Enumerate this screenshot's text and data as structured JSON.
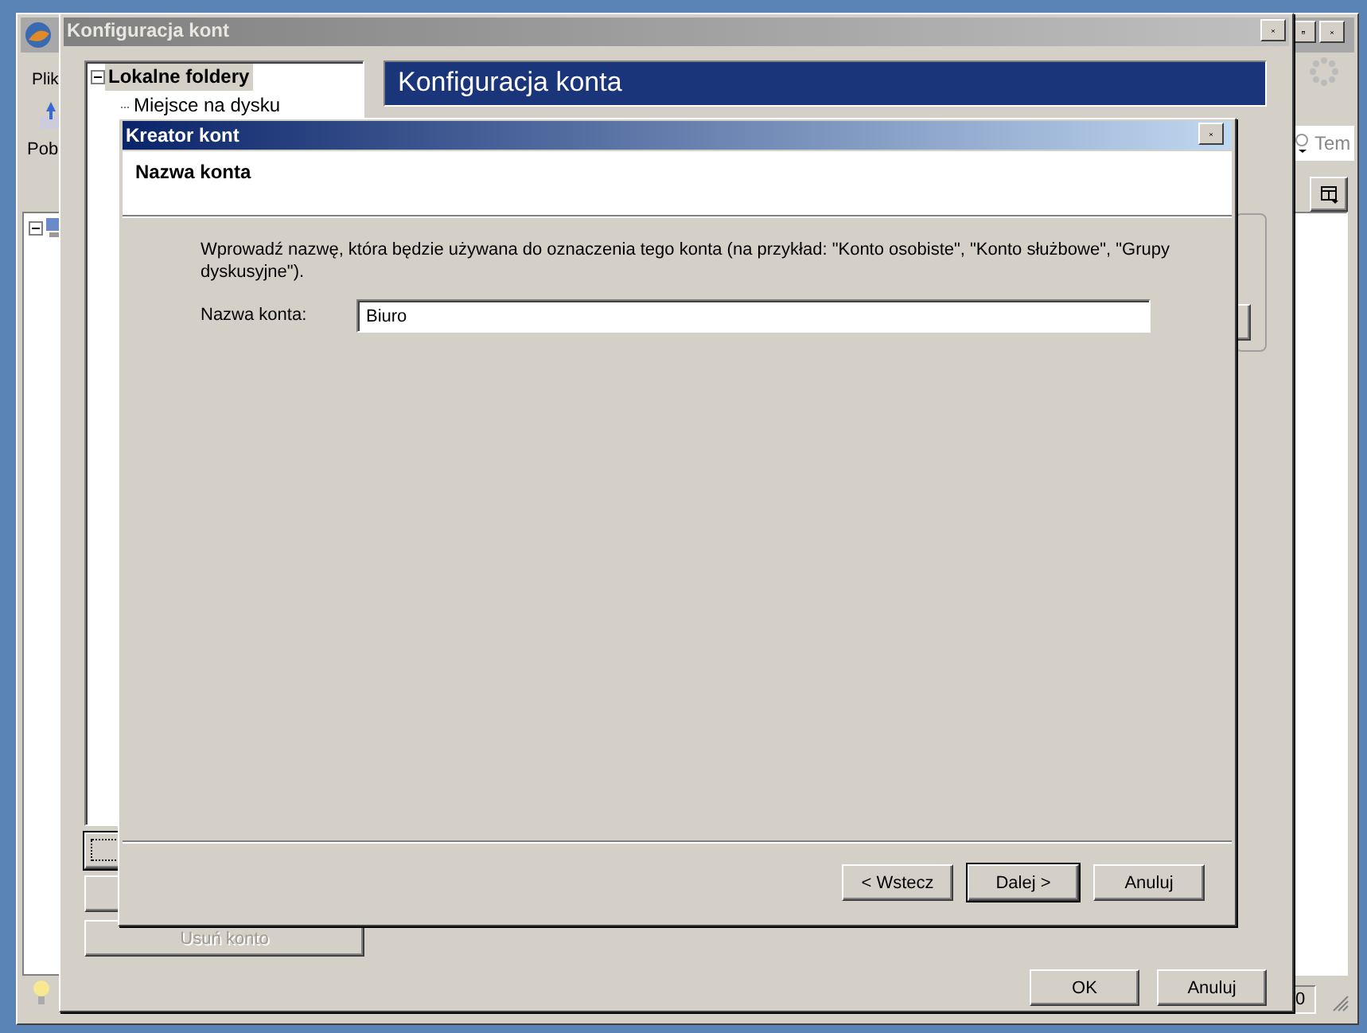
{
  "main_window": {
    "menu": [
      "Plik"
    ],
    "toolbar": [
      "Pob"
    ],
    "search_placeholder": "Tem",
    "status_count": "0"
  },
  "accounts_dialog": {
    "title": "Konfiguracja kont",
    "active": false,
    "tree": [
      {
        "label": "Lokalne foldery",
        "selected": true,
        "expanded": true,
        "children": [
          {
            "label": "Miejsce na dysku",
            "selected": false
          }
        ]
      }
    ],
    "header": "Konfiguracja konta",
    "side_buttons": [
      {
        "focused": true
      },
      {
        "focused": false
      },
      {
        "label": "Usuń konto",
        "focused": false,
        "disabled": true
      }
    ],
    "buttons": [
      {
        "label": "OK"
      },
      {
        "label": "Anuluj"
      }
    ]
  },
  "wizard": {
    "title": "Kreator kont",
    "active": true,
    "page_title": "Nazwa konta",
    "description": "Wprowadź nazwę, która będzie używana do oznaczenia tego konta (na przykład: \"Konto osobiste\", \"Konto służbowe\", \"Grupy dyskusyjne\").",
    "field": {
      "label": "Nazwa konta:",
      "value": "Biuro"
    },
    "buttons": [
      {
        "label": "< Wstecz",
        "default": false
      },
      {
        "label": "Dalej >",
        "default": true
      },
      {
        "label": "Anuluj",
        "default": false
      }
    ]
  }
}
